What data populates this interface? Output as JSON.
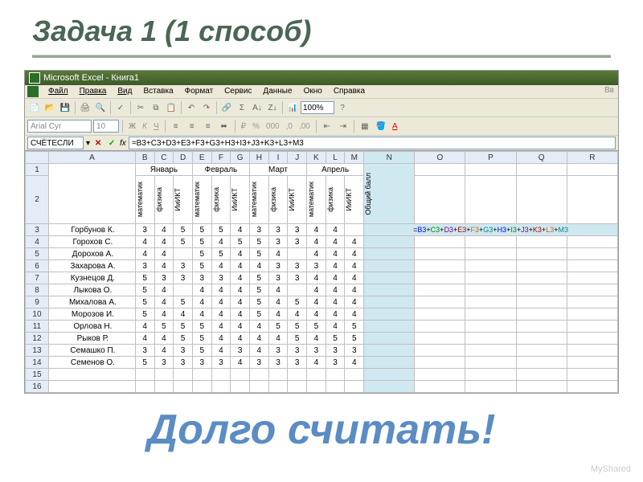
{
  "slide_title": "Задача 1 (1 способ)",
  "window_title": "Microsoft Excel - Книга1",
  "menus": [
    "Файл",
    "Правка",
    "Вид",
    "Вставка",
    "Формат",
    "Сервис",
    "Данные",
    "Окно",
    "Справка"
  ],
  "menu_right": "Вв",
  "zoom": "100%",
  "font_name": "Arial Cyr",
  "font_size": "10",
  "name_box": "СЧЁТЕСЛИ",
  "formula": "=B3+C3+D3+E3+F3+G3+H3+I3+J3+K3+L3+M3",
  "cols": [
    "A",
    "B",
    "C",
    "D",
    "E",
    "F",
    "G",
    "H",
    "I",
    "J",
    "K",
    "L",
    "M",
    "N",
    "O",
    "P",
    "Q",
    "R"
  ],
  "months": [
    "Январь",
    "Февраль",
    "Март",
    "Апрель"
  ],
  "subjects": [
    "математик",
    "физика",
    "ИиИКТ"
  ],
  "total_label": "Общий балл",
  "rows": [
    {
      "n": 3,
      "name": "Горбунов К.",
      "v": [
        3,
        4,
        5,
        5,
        5,
        4,
        3,
        3,
        3,
        4,
        4
      ],
      "f": "=B3+C3+D3+E3+F3+G3+H3+I3+J3+K3+L3+M3"
    },
    {
      "n": 4,
      "name": "Горохов С.",
      "v": [
        4,
        4,
        5,
        5,
        4,
        5,
        5,
        3,
        3,
        4,
        4,
        4
      ]
    },
    {
      "n": 5,
      "name": "Дорохов А.",
      "v": [
        4,
        4,
        "",
        5,
        5,
        4,
        5,
        4,
        "",
        4,
        4,
        4
      ]
    },
    {
      "n": 6,
      "name": "Захарова А.",
      "v": [
        3,
        4,
        3,
        5,
        4,
        4,
        4,
        3,
        3,
        3,
        4,
        4
      ]
    },
    {
      "n": 7,
      "name": "Кузнецов Д.",
      "v": [
        5,
        3,
        3,
        3,
        3,
        4,
        5,
        3,
        3,
        4,
        4,
        4
      ]
    },
    {
      "n": 8,
      "name": "Лыкова О.",
      "v": [
        5,
        4,
        "",
        4,
        4,
        4,
        5,
        4,
        "",
        4,
        4,
        4
      ]
    },
    {
      "n": 9,
      "name": "Михалова А.",
      "v": [
        5,
        4,
        5,
        4,
        4,
        4,
        5,
        4,
        5,
        4,
        4,
        4
      ]
    },
    {
      "n": 10,
      "name": "Морозов И.",
      "v": [
        5,
        4,
        4,
        4,
        4,
        4,
        5,
        4,
        4,
        4,
        4,
        4
      ]
    },
    {
      "n": 11,
      "name": "Орлова Н.",
      "v": [
        4,
        5,
        5,
        5,
        4,
        4,
        4,
        5,
        5,
        5,
        4,
        5
      ]
    },
    {
      "n": 12,
      "name": "Рыков Р.",
      "v": [
        4,
        4,
        5,
        5,
        4,
        4,
        4,
        4,
        5,
        4,
        5,
        5
      ]
    },
    {
      "n": 13,
      "name": "Семашко П.",
      "v": [
        3,
        4,
        3,
        5,
        4,
        3,
        4,
        3,
        3,
        3,
        3,
        3
      ]
    },
    {
      "n": 14,
      "name": "Семенов О.",
      "v": [
        5,
        3,
        3,
        3,
        3,
        4,
        3,
        3,
        3,
        4,
        3,
        4
      ]
    }
  ],
  "empty_rows": [
    15,
    16
  ],
  "overlay": "Долго считать!",
  "watermark": "MyShared"
}
